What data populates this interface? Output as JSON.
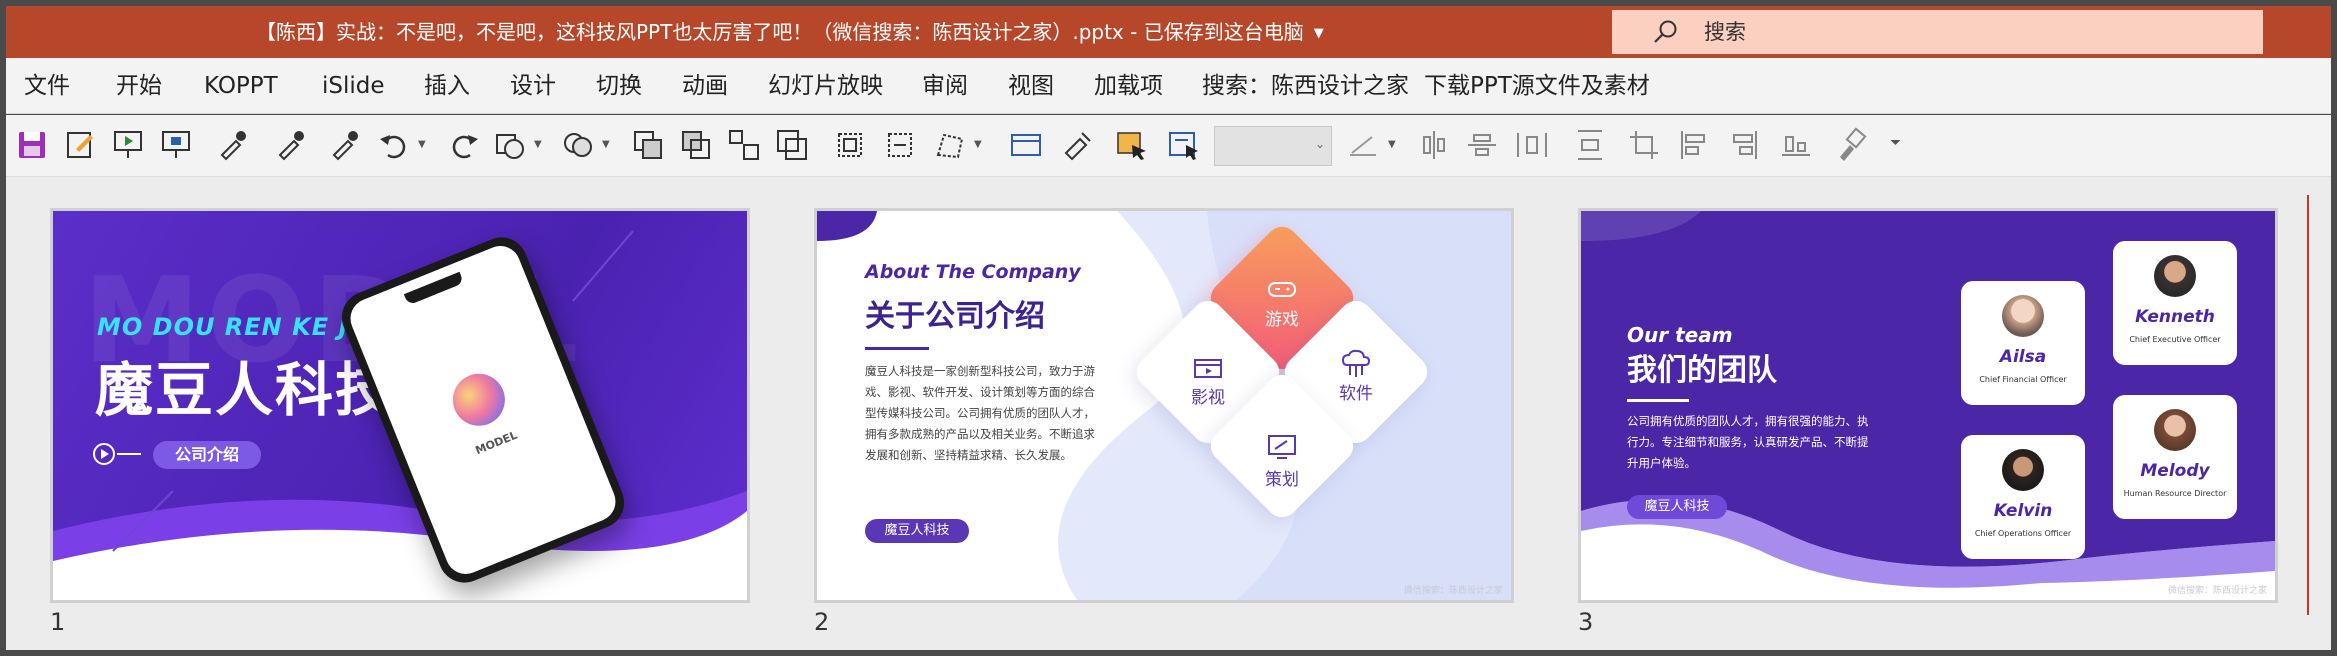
{
  "window": {
    "title": "【陈西】实战：不是吧，不是吧，这科技风PPT也太厉害了吧！（微信搜索：陈西设计之家）.pptx  -  已保存到这台电脑",
    "search_placeholder": "搜索"
  },
  "menu": {
    "items": [
      "文件",
      "开始",
      "KOPPT",
      "iSlide",
      "插入",
      "设计",
      "切换",
      "动画",
      "幻灯片放映",
      "审阅",
      "视图",
      "加载项",
      "搜索：陈西设计之家",
      "下载PPT源文件及素材"
    ]
  },
  "colors": {
    "titlebar": "#b7472a",
    "purple": "#4b27a8",
    "violet": "#7b3fe0",
    "orange_gradient_from": "#f9a05a",
    "orange_gradient_to": "#f25a7a",
    "cyan": "#39e0ff"
  },
  "slides": [
    {
      "number": "1",
      "tagline": "MO DOU REN KE JI",
      "title": "魔豆人科技",
      "bg_word": "MODEL",
      "button": "公司介绍",
      "phone_label": "MODEL"
    },
    {
      "number": "2",
      "heading_en": "About The Company",
      "heading_cn": "关于公司介绍",
      "body": "魔豆人科技是一家创新型科技公司，致力于游戏、影视、软件开发、设计策划等方面的综合型传媒科技公司。公司拥有优质的团队人才，拥有多款成熟的产品以及相关业务。不断追求发展和创新、坚持精益求精、长久发展。",
      "tag": "魔豆人科技",
      "tiles": {
        "game": "游戏",
        "film": "影视",
        "software": "软件",
        "plan": "策划"
      },
      "watermark": "微信搜索：陈西设计之家"
    },
    {
      "number": "3",
      "heading_en": "Our team",
      "heading_cn": "我们的团队",
      "body": "公司拥有优质的团队人才，拥有很强的能力、执行力。专注细节和服务，认真研发产品、不断提升用户体验。",
      "tag": "魔豆人科技",
      "members": [
        {
          "name": "Ailsa",
          "role": "Chief Financial Officer"
        },
        {
          "name": "Kenneth",
          "role": "Chief Executive Officer"
        },
        {
          "name": "Kelvin",
          "role": "Chief Operations Officer"
        },
        {
          "name": "Melody",
          "role": "Human  Resource  Director"
        }
      ],
      "watermark": "微信搜索：陈西设计之家"
    }
  ]
}
